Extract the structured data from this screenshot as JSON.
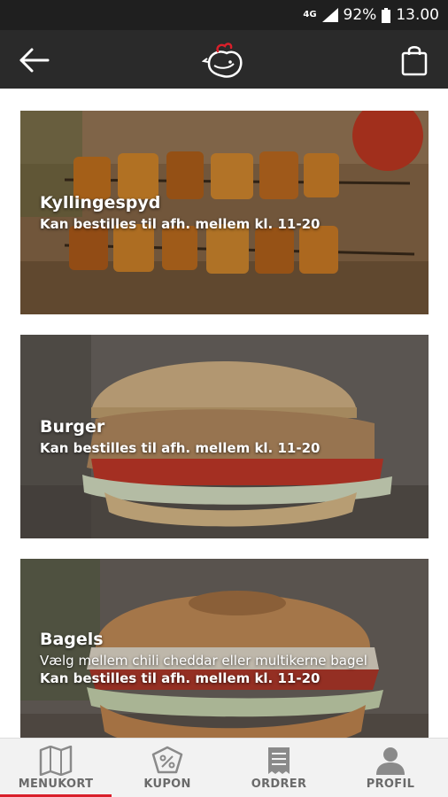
{
  "status": {
    "network": "4G",
    "battery": "92%",
    "time": "13.00"
  },
  "header": {
    "back_icon": "back-arrow-icon",
    "logo_icon": "chicken-logo-icon",
    "cart_icon": "shopping-bag-icon",
    "accent": "#d91f2a"
  },
  "menu": [
    {
      "title": "Kyllingespyd",
      "description": "",
      "subtitle": "Kan bestilles til afh. mellem kl. 11-20"
    },
    {
      "title": "Burger",
      "description": "",
      "subtitle": "Kan bestilles til afh. mellem kl. 11-20"
    },
    {
      "title": "Bagels",
      "description": "Vælg mellem chili cheddar eller multikerne bagel",
      "subtitle": "Kan bestilles til afh. mellem kl. 11-20"
    }
  ],
  "tabs": [
    {
      "label": "MENUKORT",
      "icon": "map-icon",
      "active": true
    },
    {
      "label": "KUPON",
      "icon": "coupon-icon",
      "active": false
    },
    {
      "label": "ORDRER",
      "icon": "receipt-icon",
      "active": false
    },
    {
      "label": "PROFIL",
      "icon": "person-icon",
      "active": false
    }
  ]
}
